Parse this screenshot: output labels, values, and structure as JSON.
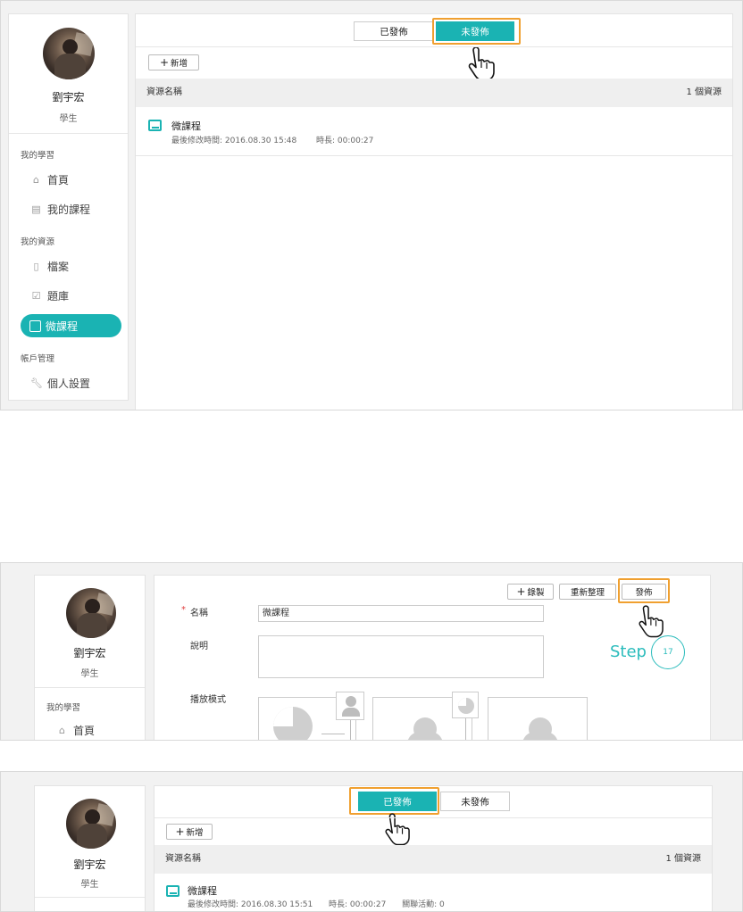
{
  "colors": {
    "accent": "#1ab3b3",
    "highlight": "#f0a030",
    "step": "#2bbcbc"
  },
  "user": {
    "name": "劉宇宏",
    "role": "學生"
  },
  "nav": {
    "section_learning": "我的學習",
    "home": "首頁",
    "my_courses": "我的課程",
    "section_resources": "我的資源",
    "files": "檔案",
    "question_bank": "題庫",
    "micro_course": "微課程",
    "section_account": "帳戶管理",
    "personal_settings": "個人設置"
  },
  "tabs": {
    "published": "已發佈",
    "unpublished": "未發佈"
  },
  "screen1": {
    "active_tab": "unpublished",
    "add_button": "新增",
    "header_name": "資源名稱",
    "header_count": "1 個資源",
    "item": {
      "name": "微課程",
      "modified": "最後修改時間: 2016.08.30 15:48",
      "duration": "時長: 00:00:27"
    }
  },
  "screen2": {
    "record_button": "錄製",
    "reorganize_button": "重新整理",
    "publish_button": "發佈",
    "name_label": "名稱",
    "name_value": "微課程",
    "description_label": "說明",
    "description_value": "",
    "playback_label": "播放模式",
    "step_label": "Step",
    "step_number": "17"
  },
  "screen3": {
    "active_tab": "published",
    "add_button": "新增",
    "header_name": "資源名稱",
    "header_count": "1 個資源",
    "item": {
      "name": "微課程",
      "modified": "最後修改時間: 2016.08.30 15:51",
      "duration": "時長: 00:00:27",
      "activities": "關聯活動: 0"
    }
  },
  "icons": [
    "home-icon",
    "document-icon",
    "file-icon",
    "quiz-icon",
    "micro-course-icon",
    "wrench-icon",
    "plus-icon",
    "hand-pointer-icon",
    "avatar"
  ]
}
